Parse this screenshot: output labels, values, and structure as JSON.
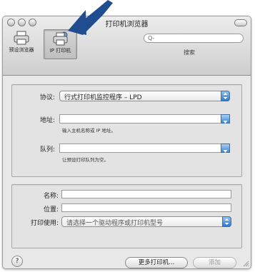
{
  "window": {
    "title": "打印机浏览器"
  },
  "toolbar": {
    "default_browser_label": "预设浏览器",
    "ip_printer_label": "IP 打印机",
    "search_placeholder": "Q-",
    "search_label": "搜索"
  },
  "protocol": {
    "label": "协议:",
    "value": "行式打印机监控程序 – LPD"
  },
  "address": {
    "label": "地址:",
    "value": "",
    "hint": "输入主机名称或 IP 地址。"
  },
  "queue": {
    "label": "队列:",
    "value": "",
    "hint": "让预设打印队列为空。"
  },
  "name": {
    "label": "名称:",
    "value": ""
  },
  "location": {
    "label": "位置:",
    "value": ""
  },
  "print_using": {
    "label": "打印使用:",
    "value": "请选择一个驱动程序或打印机型号"
  },
  "buttons": {
    "help": "?",
    "more_printers": "更多打印机...",
    "add": "添加"
  },
  "annotation": {
    "arrow_color": "#1f4d8f"
  }
}
